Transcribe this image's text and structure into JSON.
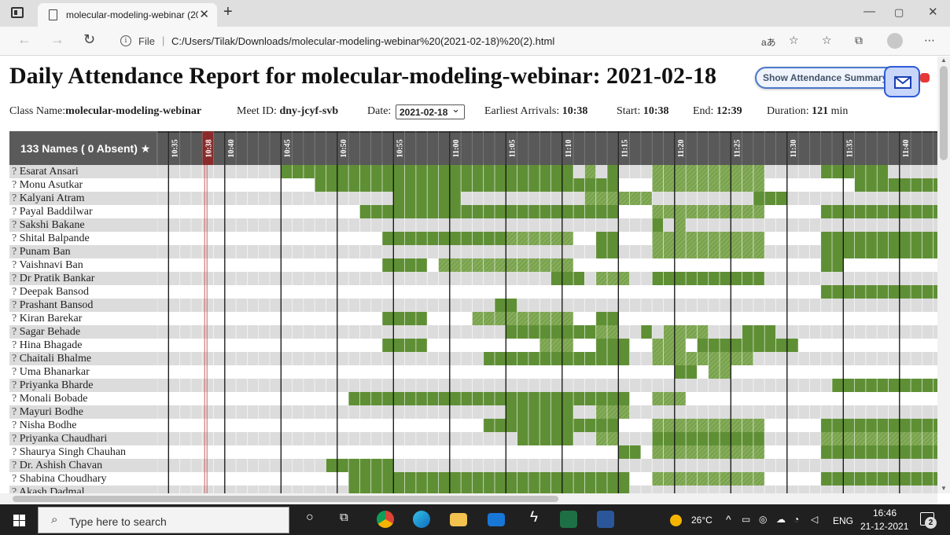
{
  "browser": {
    "tab_title": "molecular-modeling-webinar (20",
    "tab_close": "✕",
    "new_tab": "+",
    "file_label": "File",
    "url": "C:/Users/Tilak/Downloads/molecular-modeling-webinar%20(2021-02-18)%20(2).html",
    "read_aloud": "aあ"
  },
  "report": {
    "title": "Daily Attendance Report for molecular-modeling-webinar: 2021-02-18",
    "summary_button": "Show Attendance Summary",
    "class_label": "Class Name:",
    "class_name": "molecular-modeling-webinar",
    "meet_label": "Meet ID: ",
    "meet_id": "dny-jcyf-svb",
    "date_label": "Date: ",
    "date_value": "2021-02-18",
    "arrivals_label": "Earliest Arrivals: ",
    "arrivals_value": "10:38",
    "start_label": "Start: ",
    "start_value": "10:38",
    "end_label": "End: ",
    "end_value": "12:39",
    "duration_label": "Duration: ",
    "duration_value": "121",
    "duration_unit": " min",
    "names_header": "133 Names ( 0 Absent) ★"
  },
  "colors": {
    "present": "#5f8f35",
    "present_hatched": "#7aa34e",
    "header_bg": "#595959",
    "highlight": "#8b2b2b"
  },
  "timeline": {
    "start_min": 634,
    "minutes": 69,
    "labels": [
      "10:35",
      "10:38",
      "10:40",
      "10:45",
      "10:50",
      "10:55",
      "11:00",
      "11:05",
      "11:10",
      "11:15",
      "11:20",
      "11:25",
      "11:30",
      "11:35",
      "11:40"
    ],
    "highlight": "10:38"
  },
  "students": [
    {
      "name": "Esarat Ansari",
      "segs": [
        [
          11,
          36
        ],
        [
          38,
          38
        ],
        [
          40,
          40
        ],
        [
          44,
          53
        ],
        [
          59,
          64
        ]
      ]
    },
    {
      "name": "Monu Asutkar",
      "segs": [
        [
          14,
          40
        ],
        [
          44,
          53
        ],
        [
          62,
          69
        ]
      ]
    },
    {
      "name": "Kalyani Atram",
      "segs": [
        [
          21,
          26
        ],
        [
          38,
          43
        ],
        [
          53,
          55
        ]
      ]
    },
    {
      "name": "Payal Baddilwar",
      "segs": [
        [
          18,
          40
        ],
        [
          44,
          53
        ],
        [
          59,
          69
        ]
      ]
    },
    {
      "name": "Sakshi Bakane",
      "segs": [
        [
          44,
          44
        ],
        [
          46,
          46
        ]
      ]
    },
    {
      "name": "Shital Balpande",
      "segs": [
        [
          20,
          30
        ],
        [
          31,
          36
        ],
        [
          39,
          40
        ],
        [
          44,
          53
        ],
        [
          59,
          69
        ]
      ]
    },
    {
      "name": "Punam Ban",
      "segs": [
        [
          39,
          40
        ],
        [
          44,
          53
        ],
        [
          59,
          69
        ]
      ]
    },
    {
      "name": "Vaishnavi Ban",
      "segs": [
        [
          20,
          23
        ],
        [
          25,
          36
        ],
        [
          59,
          60
        ]
      ]
    },
    {
      "name": "Dr Pratik Bankar",
      "segs": [
        [
          35,
          37
        ],
        [
          39,
          41
        ],
        [
          44,
          53
        ]
      ]
    },
    {
      "name": "Deepak Bansod",
      "segs": [
        [
          59,
          69
        ]
      ]
    },
    {
      "name": "Prashant Bansod",
      "segs": [
        [
          30,
          31
        ]
      ]
    },
    {
      "name": "Kiran Barekar",
      "segs": [
        [
          20,
          23
        ],
        [
          28,
          36
        ],
        [
          39,
          40
        ]
      ]
    },
    {
      "name": "Sagar Behade",
      "segs": [
        [
          31,
          38
        ],
        [
          39,
          40
        ],
        [
          43,
          43
        ],
        [
          45,
          48
        ],
        [
          52,
          54
        ]
      ]
    },
    {
      "name": "Hina Bhagade",
      "segs": [
        [
          20,
          23
        ],
        [
          34,
          36
        ],
        [
          39,
          41
        ],
        [
          44,
          46
        ],
        [
          48,
          56
        ]
      ]
    },
    {
      "name": "Chaitali Bhalme",
      "segs": [
        [
          29,
          41
        ],
        [
          44,
          52
        ]
      ]
    },
    {
      "name": "Uma Bhanarkar",
      "segs": [
        [
          46,
          47
        ],
        [
          49,
          50
        ]
      ]
    },
    {
      "name": "Priyanka Bharde",
      "segs": [
        [
          60,
          69
        ]
      ]
    },
    {
      "name": "Monali Bobade",
      "segs": [
        [
          17,
          41
        ],
        [
          44,
          46
        ]
      ]
    },
    {
      "name": "Mayuri Bodhe",
      "segs": [
        [
          31,
          36
        ],
        [
          39,
          41
        ]
      ]
    },
    {
      "name": "Nisha Bodhe",
      "segs": [
        [
          29,
          40
        ],
        [
          44,
          53
        ],
        [
          59,
          69
        ]
      ]
    },
    {
      "name": "Priyanka Chaudhari",
      "segs": [
        [
          32,
          36
        ],
        [
          39,
          40
        ],
        [
          44,
          53
        ],
        [
          59,
          69
        ]
      ]
    },
    {
      "name": "Shaurya Singh Chauhan",
      "segs": [
        [
          41,
          42
        ],
        [
          44,
          53
        ],
        [
          59,
          69
        ]
      ]
    },
    {
      "name": "Dr. Ashish Chavan",
      "segs": [
        [
          15,
          20
        ]
      ]
    },
    {
      "name": "Shabina Choudhary",
      "segs": [
        [
          17,
          41
        ],
        [
          44,
          53
        ],
        [
          59,
          69
        ]
      ]
    },
    {
      "name": "Akash Dadmal",
      "segs": [
        [
          17,
          41
        ]
      ]
    }
  ],
  "taskbar": {
    "search_placeholder": "Type here to search",
    "temperature": "26°C",
    "language": "ENG",
    "time": "16:46",
    "date": "21-12-2021",
    "notifications": "2"
  }
}
